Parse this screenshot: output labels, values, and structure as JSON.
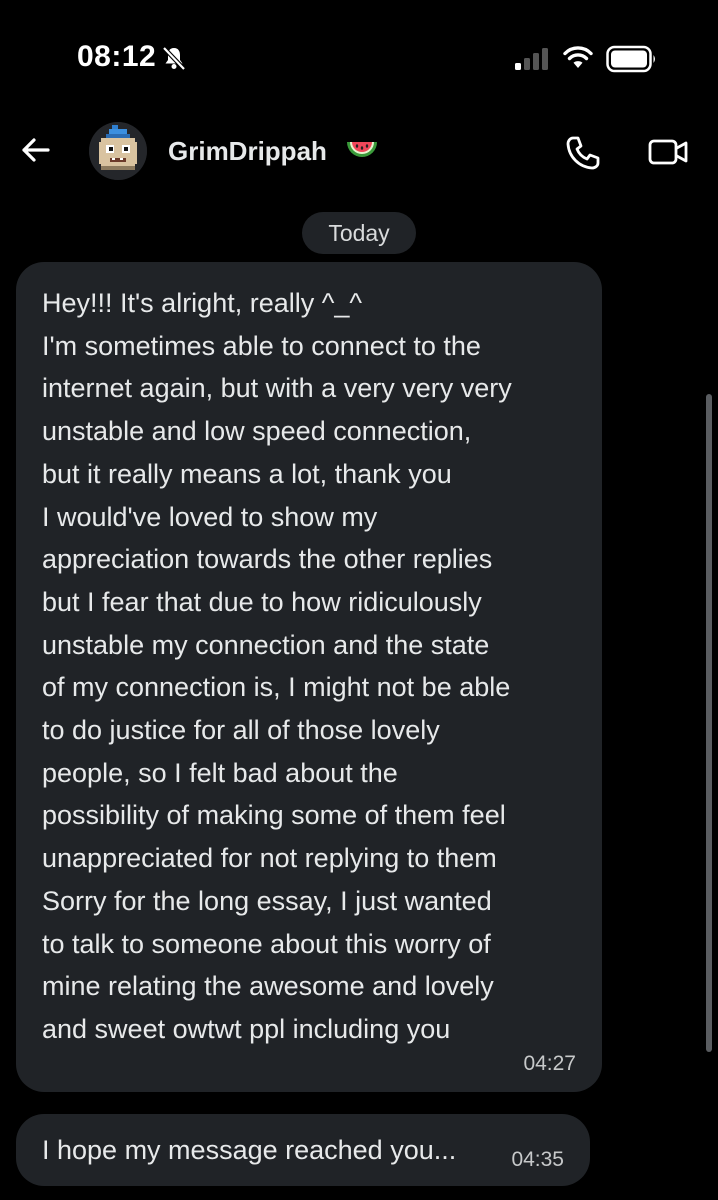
{
  "status_bar": {
    "time": "08:12",
    "silent_icon": "bell-slash-icon",
    "signal_icon": "cellular-signal-icon",
    "wifi_icon": "wifi-icon",
    "battery_icon": "battery-icon"
  },
  "header": {
    "back_icon": "arrow-left-icon",
    "contact_name": "GrimDrippah",
    "name_emoji": "watermelon-icon",
    "call_icon": "phone-icon",
    "video_icon": "video-camera-icon"
  },
  "date_separator": "Today",
  "messages": [
    {
      "lines": [
        "Hey!!! It's alright, really ^_^",
        "I'm sometimes able to connect to the",
        "internet again, but with a very very very",
        "unstable and low speed connection,",
        "but it really means a lot, thank you",
        "I would've loved to show my",
        "appreciation towards the other replies",
        "but I fear that due to how ridiculously",
        "unstable my connection and the state",
        "of my connection is, I might not be able",
        "to do justice for all of those lovely",
        "people, so I felt bad about the",
        "possibility of making some of them feel",
        "unappreciated for not replying to them",
        "Sorry for the long essay, I just wanted",
        "to talk to someone about this worry of",
        "mine relating the awesome and lovely",
        "and sweet owtwt ppl including you"
      ],
      "time": "04:27"
    },
    {
      "text": "I hope my message reached you...",
      "time": "04:35"
    }
  ],
  "colors": {
    "background": "#000000",
    "bubble": "#202327",
    "text": "#e7e9ea"
  }
}
